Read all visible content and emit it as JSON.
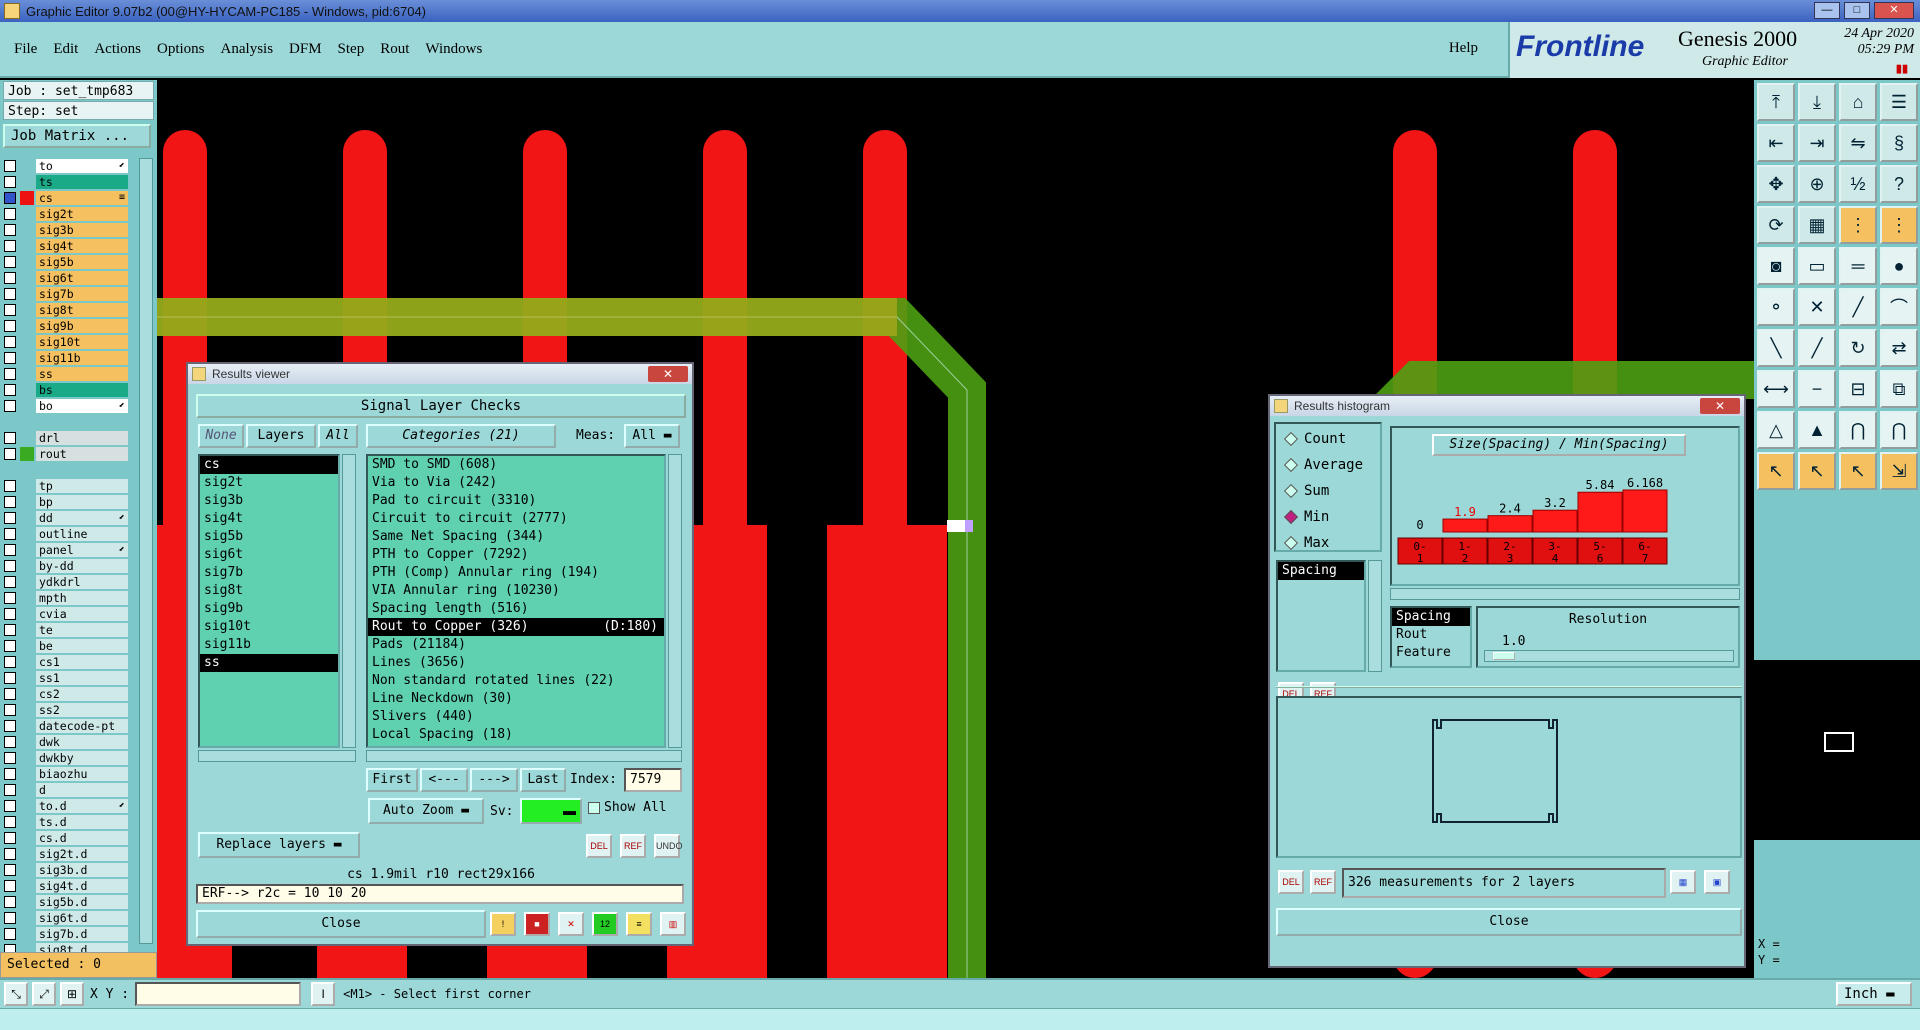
{
  "window": {
    "title": "Graphic Editor 9.07b2 (00@HY-HYCAM-PC185 - Windows, pid:6704)",
    "buttons": [
      "—",
      "□",
      "✕"
    ]
  },
  "menu": {
    "items": [
      "File",
      "Edit",
      "Actions",
      "Options",
      "Analysis",
      "DFM",
      "Step",
      "Rout",
      "Windows"
    ],
    "help": "Help"
  },
  "brand": {
    "logo": "Frontline",
    "product": "Genesis 2000",
    "subtitle": "Graphic Editor",
    "date": "24 Apr 2020",
    "time": "05:29 PM"
  },
  "left": {
    "job": "Job : set_tmp683",
    "step": "Step: set",
    "job_matrix": "Job Matrix ...",
    "layers": [
      {
        "name": "to",
        "color": "#ffffff",
        "swatch": "#7cc7c7",
        "mark": "⬋"
      },
      {
        "name": "ts",
        "color": "#1aaa88",
        "swatch": "#7cc7c7",
        "mark": ""
      },
      {
        "name": "cs",
        "color": "#f4c060",
        "swatch": "#ee1111",
        "mark": "≡",
        "active": true
      },
      {
        "name": "sig2t",
        "color": "#f4c060",
        "swatch": "#7cc7c7",
        "mark": ""
      },
      {
        "name": "sig3b",
        "color": "#f4c060",
        "swatch": "#7cc7c7",
        "mark": ""
      },
      {
        "name": "sig4t",
        "color": "#f4c060",
        "swatch": "#7cc7c7",
        "mark": ""
      },
      {
        "name": "sig5b",
        "color": "#f4c060",
        "swatch": "#7cc7c7",
        "mark": ""
      },
      {
        "name": "sig6t",
        "color": "#f4c060",
        "swatch": "#7cc7c7",
        "mark": ""
      },
      {
        "name": "sig7b",
        "color": "#f4c060",
        "swatch": "#7cc7c7",
        "mark": ""
      },
      {
        "name": "sig8t",
        "color": "#f4c060",
        "swatch": "#7cc7c7",
        "mark": ""
      },
      {
        "name": "sig9b",
        "color": "#f4c060",
        "swatch": "#7cc7c7",
        "mark": ""
      },
      {
        "name": "sig10t",
        "color": "#f4c060",
        "swatch": "#7cc7c7",
        "mark": ""
      },
      {
        "name": "sig11b",
        "color": "#f4c060",
        "swatch": "#7cc7c7",
        "mark": ""
      },
      {
        "name": "ss",
        "color": "#f4c060",
        "swatch": "#7cc7c7",
        "mark": ""
      },
      {
        "name": "bs",
        "color": "#1aaa88",
        "swatch": "#7cc7c7",
        "mark": ""
      },
      {
        "name": "bo",
        "color": "#ffffff",
        "swatch": "#7cc7c7",
        "mark": "⬋"
      },
      {
        "name": "",
        "color": "#7cc7c7",
        "swatch": "#7cc7c7",
        "mark": ""
      },
      {
        "name": "drl",
        "color": "#d6e0e0",
        "swatch": "#7cc7c7",
        "mark": ""
      },
      {
        "name": "rout",
        "color": "#d6e0e0",
        "swatch": "#3aaa20",
        "mark": ""
      },
      {
        "name": "",
        "color": "#7cc7c7",
        "swatch": "#7cc7c7",
        "mark": ""
      },
      {
        "name": "tp",
        "color": "#cfe9e9",
        "swatch": "#7cc7c7",
        "mark": ""
      },
      {
        "name": "bp",
        "color": "#cfe9e9",
        "swatch": "#7cc7c7",
        "mark": ""
      },
      {
        "name": "dd",
        "color": "#cfe9e9",
        "swatch": "#7cc7c7",
        "mark": "⬋"
      },
      {
        "name": "outline",
        "color": "#cfe9e9",
        "swatch": "#7cc7c7",
        "mark": ""
      },
      {
        "name": "panel",
        "color": "#cfe9e9",
        "swatch": "#7cc7c7",
        "mark": "⬋"
      },
      {
        "name": "by-dd",
        "color": "#cfe9e9",
        "swatch": "#7cc7c7",
        "mark": ""
      },
      {
        "name": "ydkdrl",
        "color": "#cfe9e9",
        "swatch": "#7cc7c7",
        "mark": ""
      },
      {
        "name": "mpth",
        "color": "#cfe9e9",
        "swatch": "#7cc7c7",
        "mark": ""
      },
      {
        "name": "cvia",
        "color": "#cfe9e9",
        "swatch": "#7cc7c7",
        "mark": ""
      },
      {
        "name": "te",
        "color": "#cfe9e9",
        "swatch": "#7cc7c7",
        "mark": ""
      },
      {
        "name": "be",
        "color": "#cfe9e9",
        "swatch": "#7cc7c7",
        "mark": ""
      },
      {
        "name": "cs1",
        "color": "#cfe9e9",
        "swatch": "#7cc7c7",
        "mark": ""
      },
      {
        "name": "ss1",
        "color": "#cfe9e9",
        "swatch": "#7cc7c7",
        "mark": ""
      },
      {
        "name": "cs2",
        "color": "#cfe9e9",
        "swatch": "#7cc7c7",
        "mark": ""
      },
      {
        "name": "ss2",
        "color": "#cfe9e9",
        "swatch": "#7cc7c7",
        "mark": ""
      },
      {
        "name": "datecode-pt",
        "color": "#cfe9e9",
        "swatch": "#7cc7c7",
        "mark": ""
      },
      {
        "name": "dwk",
        "color": "#cfe9e9",
        "swatch": "#7cc7c7",
        "mark": ""
      },
      {
        "name": "dwkby",
        "color": "#cfe9e9",
        "swatch": "#7cc7c7",
        "mark": ""
      },
      {
        "name": "biaozhu",
        "color": "#cfe9e9",
        "swatch": "#7cc7c7",
        "mark": ""
      },
      {
        "name": "d",
        "color": "#cfe9e9",
        "swatch": "#7cc7c7",
        "mark": ""
      },
      {
        "name": "to.d",
        "color": "#cfe9e9",
        "swatch": "#7cc7c7",
        "mark": "⬋"
      },
      {
        "name": "ts.d",
        "color": "#cfe9e9",
        "swatch": "#7cc7c7",
        "mark": ""
      },
      {
        "name": "cs.d",
        "color": "#cfe9e9",
        "swatch": "#7cc7c7",
        "mark": ""
      },
      {
        "name": "sig2t.d",
        "color": "#cfe9e9",
        "swatch": "#7cc7c7",
        "mark": ""
      },
      {
        "name": "sig3b.d",
        "color": "#cfe9e9",
        "swatch": "#7cc7c7",
        "mark": ""
      },
      {
        "name": "sig4t.d",
        "color": "#cfe9e9",
        "swatch": "#7cc7c7",
        "mark": ""
      },
      {
        "name": "sig5b.d",
        "color": "#cfe9e9",
        "swatch": "#7cc7c7",
        "mark": ""
      },
      {
        "name": "sig6t.d",
        "color": "#cfe9e9",
        "swatch": "#7cc7c7",
        "mark": ""
      },
      {
        "name": "sig7b.d",
        "color": "#cfe9e9",
        "swatch": "#7cc7c7",
        "mark": ""
      },
      {
        "name": "sig8t.d",
        "color": "#cfe9e9",
        "swatch": "#7cc7c7",
        "mark": ""
      }
    ],
    "selected": "Selected : 0"
  },
  "results_viewer": {
    "title": "Results viewer",
    "close_x": "✕",
    "header": "Signal Layer Checks",
    "none_btn": "None",
    "layers_btn": "Layers",
    "all_btn": "All",
    "layers": [
      "cs",
      "sig2t",
      "sig3b",
      "sig4t",
      "sig5b",
      "sig6t",
      "sig7b",
      "sig8t",
      "sig9b",
      "sig10t",
      "sig11b",
      "ss"
    ],
    "categories_btn": "Categories (21)",
    "meas_label": "Meas:",
    "meas_value": "All",
    "categories": [
      {
        "label": "SMD to SMD (608)"
      },
      {
        "label": "Via to Via (242)"
      },
      {
        "label": "Pad to circuit (3310)"
      },
      {
        "label": "Circuit to circuit (2777)"
      },
      {
        "label": "Same Net Spacing (344)"
      },
      {
        "label": "PTH to Copper (7292)"
      },
      {
        "label": "PTH (Comp) Annular ring (194)"
      },
      {
        "label": "VIA Annular ring (10230)"
      },
      {
        "label": "Spacing length (516)"
      },
      {
        "label": "Rout to Copper (326)",
        "detail": "(D:180)",
        "selected": true
      },
      {
        "label": "Pads (21184)"
      },
      {
        "label": "Lines (3656)"
      },
      {
        "label": "Non standard rotated lines (22)"
      },
      {
        "label": "Line Neckdown (30)"
      },
      {
        "label": "Slivers (440)"
      },
      {
        "label": "Local Spacing (18)"
      }
    ],
    "first": "First",
    "prev": "<---",
    "next": "--->",
    "last": "Last",
    "index_label": "Index:",
    "index_value": "7579",
    "auto_zoom": "Auto Zoom",
    "sv_label": "Sv:",
    "show_all": "Show All",
    "replace_layers": "Replace layers",
    "del": "DEL",
    "ref": "REF",
    "undo": "UNDO",
    "info": "cs 1.9mil  r10  rect29x166",
    "erf": "ERF--> r2c = 10 10 20",
    "close": "Close"
  },
  "results_histogram": {
    "title": "Results histogram",
    "close_x": "✕",
    "modes": [
      "Count",
      "Average",
      "Sum",
      "Min",
      "Max"
    ],
    "mode_selected": "Min",
    "spacing_list": [
      "Spacing"
    ],
    "chart_title": "Size(Spacing) / Min(Spacing)",
    "bar_colors": {
      "fill": "#ff1a1a",
      "highlight": "#e01010"
    },
    "footer": "326 measurements for 2 layers",
    "res_list": [
      "Spacing",
      "Rout",
      "Feature"
    ],
    "resolution_label": "Resolution",
    "resolution_value": "1.0",
    "del": "DEL",
    "ref": "REF",
    "close": "Close"
  },
  "chart_data": {
    "type": "bar",
    "title": "Size(Spacing) / Min(Spacing)",
    "categories": [
      "0-1",
      "1-2",
      "2-3",
      "3-4",
      "5-6",
      "6-7"
    ],
    "values": [
      0,
      1.9,
      2.4,
      3.2,
      5.84,
      6.168
    ],
    "value_labels": [
      "0",
      "1.9",
      "2.4",
      "3.2",
      "5.84",
      "6.168"
    ],
    "bin_top": [
      "0-",
      "1-",
      "2-",
      "3-",
      "5-",
      "6-"
    ],
    "bin_bottom": [
      "1",
      "2",
      "3",
      "4",
      "6",
      "7"
    ],
    "grid": false
  },
  "right": {
    "xy_x": "X =",
    "xy_y": "Y ="
  },
  "bottom": {
    "xy_label": "X Y :",
    "prompt": "<M1> - Select first corner",
    "unit": "Inch"
  }
}
